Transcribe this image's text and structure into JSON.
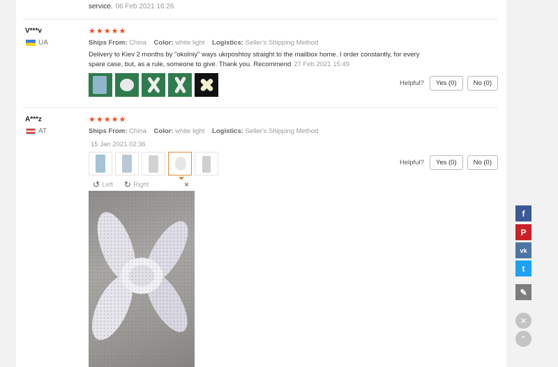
{
  "previous_review": {
    "text_tail": "service.",
    "date": "06 Feb 2021 16:26"
  },
  "reviews": [
    {
      "user": "V***v",
      "country": "UA",
      "stars": "★★★★★",
      "ships_from_label": "Ships From:",
      "ships_from": "China",
      "color_label": "Color:",
      "color": "white light",
      "logistics_label": "Logistics:",
      "logistics": "Seller's Shipping Method",
      "text": "Delivery to Kiev 2 months by \"okolniy\" ways ukrposhtoy straight to the mailbox home. I order constantly, for every spare case, but, as a rule, someone to give. Thank you. Recommend",
      "date": "27 Feb 2021 15:49",
      "helpful_label": "Helpful?",
      "yes_label": "Yes (0)",
      "no_label": "No (0)"
    },
    {
      "user": "A***z",
      "country": "AT",
      "stars": "★★★★★",
      "ships_from_label": "Ships From:",
      "ships_from": "China",
      "color_label": "Color:",
      "color": "white light",
      "logistics_label": "Logistics:",
      "logistics": "Seller's Shipping Method",
      "date": "15 Jan 2021 02:36",
      "helpful_label": "Helpful?",
      "yes_label": "Yes (0)",
      "no_label": "No (0)"
    }
  ],
  "viewer": {
    "rotate_left_label": "Left",
    "rotate_right_label": "Right",
    "close_glyph": "×"
  },
  "share": {
    "facebook": "f",
    "pinterest": "P",
    "vk": "vk",
    "twitter": "t",
    "edit": "✎"
  },
  "floating": {
    "close_glyph": "✕",
    "top_glyph": "⌃"
  },
  "icons": {
    "rotate_left": "rotate-left-icon",
    "rotate_right": "rotate-right-icon"
  },
  "colors": {
    "stars": "#f04a1f",
    "facebook": "#3b5998",
    "pinterest": "#cb2027",
    "vk": "#4c75a3",
    "twitter": "#1da1f2"
  }
}
